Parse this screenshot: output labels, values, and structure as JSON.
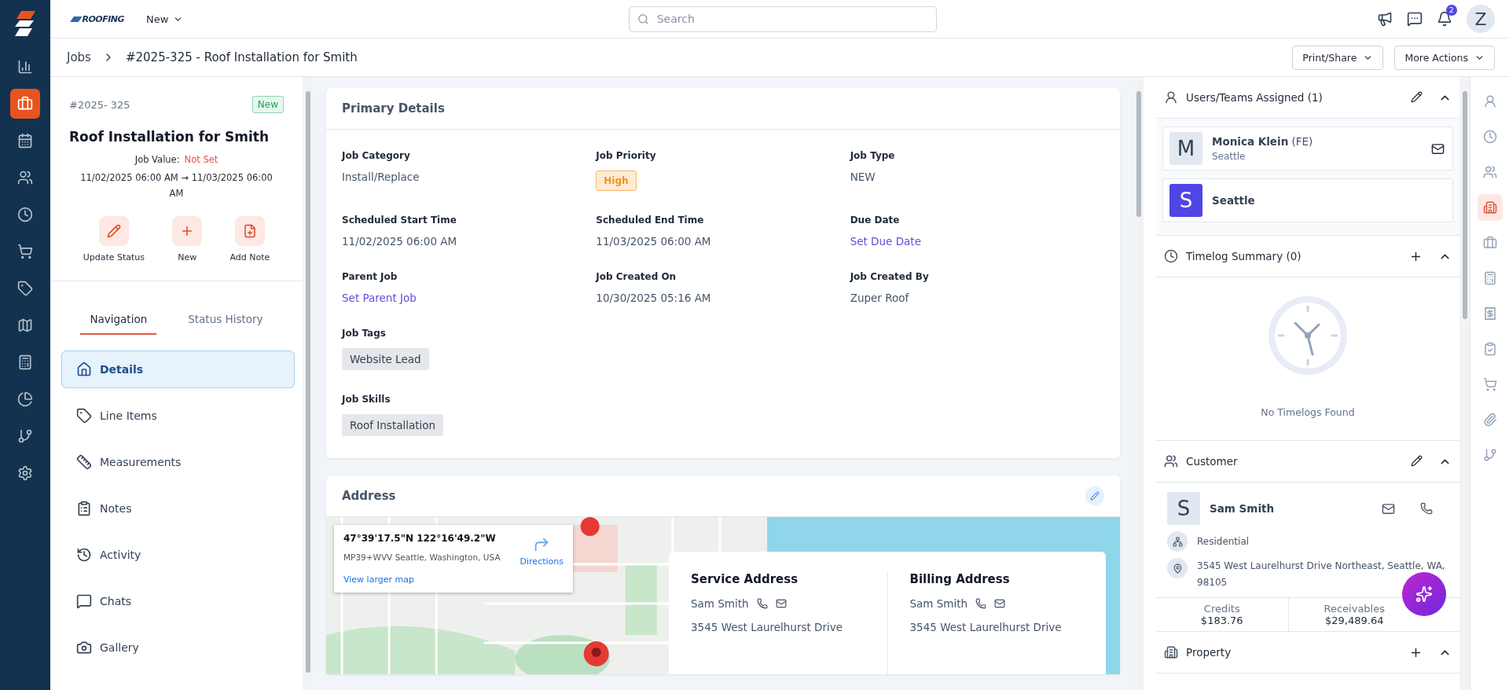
{
  "rail": {
    "items": [
      {
        "selected": false
      },
      {
        "selected": true
      },
      {
        "selected": false
      },
      {
        "selected": false
      },
      {
        "selected": false
      },
      {
        "selected": false
      },
      {
        "selected": false
      },
      {
        "selected": false
      },
      {
        "selected": false
      },
      {
        "selected": false
      },
      {
        "selected": false
      },
      {
        "selected": false
      }
    ]
  },
  "topbar": {
    "logo": "ROOFING",
    "new_menu": "New",
    "search": {
      "placeholder": "Search"
    },
    "notifications": "2",
    "avatar": "Z"
  },
  "breadcrumb": {
    "root": "Jobs",
    "title": "#2025-325 - Roof Installation for Smith"
  },
  "actions": [
    "Print/Share",
    "More Actions"
  ],
  "job": {
    "number": "#2025- 325",
    "status": "New",
    "title": "Roof Installation for Smith",
    "value_label": "Job Value:",
    "value": "Not Set",
    "dates": "11/02/2025 06:00 AM → 11/03/2025 06:00 AM",
    "quick_actions": [
      {
        "kind": "edit",
        "label": "Update Status"
      },
      {
        "kind": "add",
        "label": "New"
      },
      {
        "kind": "note",
        "label": "Add Note"
      }
    ]
  },
  "tabs": [
    {
      "label": "Navigation",
      "selected": true
    },
    {
      "label": "Status History",
      "selected": false
    }
  ],
  "nav": [
    {
      "kind": "home",
      "label": "Details",
      "selected": true
    },
    {
      "kind": "tag",
      "label": "Line Items",
      "selected": false
    },
    {
      "kind": "ruler",
      "label": "Measurements",
      "selected": false
    },
    {
      "kind": "clipboard",
      "label": "Notes",
      "selected": false
    },
    {
      "kind": "history",
      "label": "Activity",
      "selected": false
    },
    {
      "kind": "chat",
      "label": "Chats",
      "selected": false
    },
    {
      "kind": "camera",
      "label": "Gallery",
      "selected": false
    }
  ],
  "primary_details": {
    "title": "Primary Details",
    "fields": [
      {
        "label": "Job Category",
        "value": "Install/Replace",
        "kind": "text"
      },
      {
        "label": "Job Priority",
        "value": "High",
        "kind": "priority"
      },
      {
        "label": "Job Type",
        "value": "NEW",
        "kind": "text"
      },
      {
        "label": "Scheduled Start Time",
        "value": "11/02/2025 06:00 AM",
        "kind": "text"
      },
      {
        "label": "Scheduled End Time",
        "value": "11/03/2025 06:00 AM",
        "kind": "text"
      },
      {
        "label": "Due Date",
        "value": "Set Due Date",
        "kind": "link"
      },
      {
        "label": "Parent Job",
        "value": "Set Parent Job",
        "kind": "link"
      },
      {
        "label": "Job Created On",
        "value": "10/30/2025 05:16 AM",
        "kind": "text"
      },
      {
        "label": "Job Created By",
        "value": "Zuper Roof",
        "kind": "text"
      },
      {
        "label": "Job Tags",
        "value": "Website Lead",
        "kind": "tag"
      },
      {
        "label": "Job Skills",
        "value": "Roof Installation",
        "kind": "tag"
      }
    ]
  },
  "address": {
    "title": "Address",
    "map": {
      "kind": "picture",
      "coordinates": "47°39'17.5\"N 122°16'49.2\"W",
      "plus_code": "MP39+WVV Seattle, Washington, USA",
      "directions": "Directions",
      "larger_map": "View larger map"
    },
    "columns": [
      {
        "title": "Service Address",
        "name": "Sam Smith",
        "street": "3545 West Laurelhurst Drive"
      },
      {
        "title": "Billing Address",
        "name": "Sam Smith",
        "street": "3545 West Laurelhurst Drive"
      }
    ]
  },
  "users_teams": {
    "title": "Users/Teams Assigned (1)",
    "members": [
      {
        "kind": "user",
        "initial": "M",
        "name": "Monica Klein",
        "role": "(FE)",
        "team": "Seattle"
      },
      {
        "kind": "team",
        "initial": "S",
        "name": "Seattle"
      }
    ]
  },
  "timelog": {
    "title": "Timelog Summary (0)",
    "empty": "No Timelogs Found"
  },
  "customer": {
    "title": "Customer",
    "initial": "S",
    "name": "Sam Smith",
    "type": "Residential",
    "address": "3545 West Laurelhurst Drive Northeast, Seattle, WA, 98105",
    "stats": [
      {
        "label": "Credits",
        "value": "$183.76"
      },
      {
        "label": "Receivables",
        "value": "$29,489.64"
      }
    ]
  },
  "property": {
    "title": "Property"
  },
  "side_rail": {
    "items": [
      {
        "selected": false
      },
      {
        "selected": false
      },
      {
        "selected": false
      },
      {
        "selected": true
      },
      {
        "selected": false
      },
      {
        "selected": false
      },
      {
        "selected": false
      },
      {
        "selected": false
      },
      {
        "selected": false
      },
      {
        "selected": false
      },
      {
        "selected": false
      }
    ]
  }
}
